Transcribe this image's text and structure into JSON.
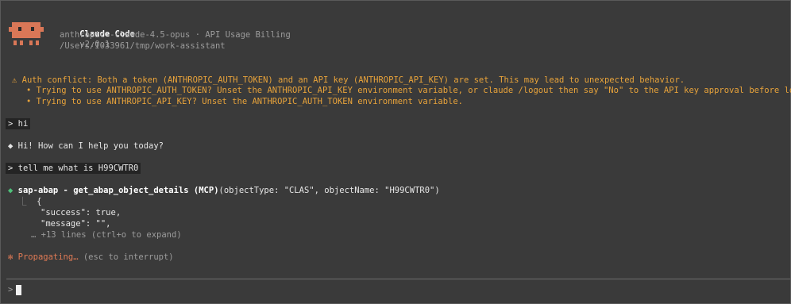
{
  "header": {
    "app_name": "Claude Code",
    "version": "v2.0.1",
    "model": "anthropic--claude-4.5-opus",
    "separator": "·",
    "billing": "API Usage Billing",
    "cwd": "/Users/I033961/tmp/work-assistant"
  },
  "warning": {
    "icon": "⚠",
    "title": "Auth conflict: Both a token (ANTHROPIC_AUTH_TOKEN) and an API key (ANTHROPIC_API_KEY) are set. This may lead to unexpected behavior.",
    "bullet": "•",
    "items": [
      "Trying to use ANTHROPIC_AUTH_TOKEN? Unset the ANTHROPIC_API_KEY environment variable, or claude /logout then say \"No\" to the API key approval before login.",
      "Trying to use ANTHROPIC_API_KEY? Unset the ANTHROPIC_AUTH_TOKEN environment variable."
    ]
  },
  "conversation": {
    "prompt_char": ">",
    "user_1": "hi",
    "reply_bullet": "◆",
    "assistant_1": "Hi! How can I help you today?",
    "user_2": "tell me what is H99CWTR0",
    "tool_call": {
      "name": "sap-abap - get_abap_object_details (MCP)",
      "args": "(objectType: \"CLAS\", objectName: \"H99CWTR0\")",
      "result_prefix": "⎿",
      "result_lines": [
        "{",
        "\"success\": true,",
        "\"message\": \"\","
      ],
      "more_lines": "… +13 lines (ctrl+o to expand)"
    },
    "status": {
      "spinner": "✻",
      "label": "Propagating…",
      "hint": "(esc to interrupt)"
    }
  },
  "input": {
    "prompt_char": ">",
    "value": ""
  },
  "colors": {
    "background": "#3a3a3a",
    "warning": "#e8a33a",
    "accent": "#e07a55",
    "success": "#4fc07a"
  }
}
